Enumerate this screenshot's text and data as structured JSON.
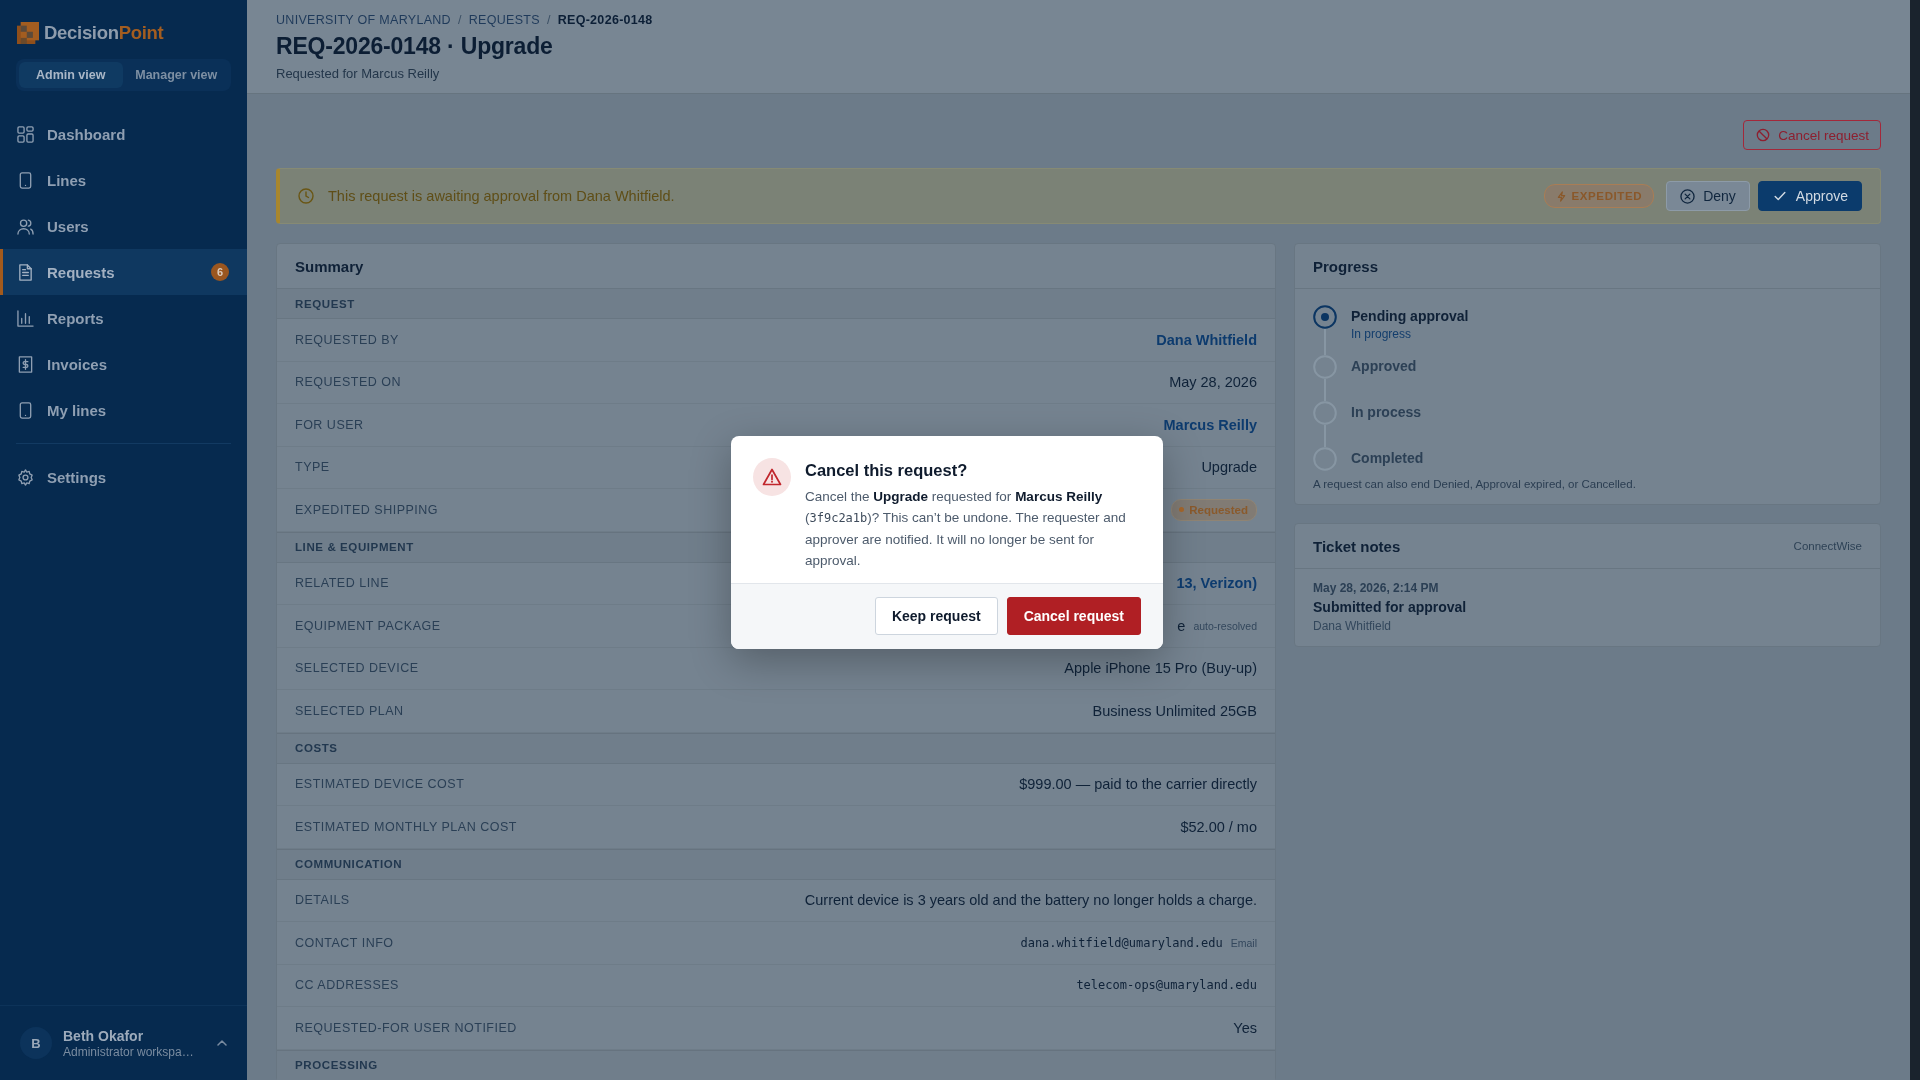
{
  "sidebar": {
    "logo": {
      "first": "Decision",
      "second": "Point"
    },
    "views": [
      {
        "label": "Admin view",
        "selected": true
      },
      {
        "label": "Manager view",
        "selected": false
      }
    ],
    "nav": [
      {
        "label": "Dashboard",
        "selected": false
      },
      {
        "label": "Lines",
        "selected": false
      },
      {
        "label": "Users",
        "selected": false
      },
      {
        "label": "Requests",
        "selected": true,
        "badge": "6"
      },
      {
        "label": "Reports",
        "selected": false
      },
      {
        "label": "Invoices",
        "selected": false
      },
      {
        "label": "My lines",
        "selected": false
      }
    ],
    "nav_footer": [
      {
        "label": "Settings",
        "selected": false
      }
    ],
    "user": {
      "initial": "B",
      "name": "Beth Okafor",
      "role": "Administrator workspa…"
    }
  },
  "header": {
    "breadcrumb": [
      {
        "label": "UNIVERSITY OF MARYLAND",
        "current": false
      },
      {
        "label": "REQUESTS",
        "current": false
      },
      {
        "label": "REQ-2026-0148",
        "current": true
      }
    ],
    "breadcrumb_separator": "/",
    "title": "REQ-2026-0148 · Upgrade",
    "subtitle": "Requested for Marcus Reilly"
  },
  "actions": {
    "cancel": "Cancel request"
  },
  "banner": {
    "message": "This request is awaiting approval from Dana Whitfield.",
    "tag": "EXPEDITED",
    "deny": "Deny",
    "approve": "Approve"
  },
  "summary": {
    "title": "Summary",
    "rows": [
      {
        "kind": "section",
        "label": "REQUEST"
      },
      {
        "kind": "link",
        "label": "REQUESTED BY",
        "value": "Dana Whitfield"
      },
      {
        "kind": "text",
        "label": "REQUESTED ON",
        "value": "May 28, 2026"
      },
      {
        "kind": "link",
        "label": "FOR USER",
        "value": "Marcus Reilly"
      },
      {
        "kind": "text",
        "label": "TYPE",
        "value": "Upgrade"
      },
      {
        "kind": "badge",
        "label": "EXPEDITED SHIPPING",
        "value": "Requested"
      },
      {
        "kind": "section",
        "label": "LINE & EQUIPMENT"
      },
      {
        "kind": "link",
        "label": "RELATED LINE",
        "value": "13, Verizon)"
      },
      {
        "kind": "text",
        "label": "EQUIPMENT PACKAGE",
        "value": "e",
        "note": "auto-resolved"
      },
      {
        "kind": "text",
        "label": "SELECTED DEVICE",
        "value": "Apple iPhone 15 Pro (Buy-up)"
      },
      {
        "kind": "text",
        "label": "SELECTED PLAN",
        "value": "Business Unlimited 25GB"
      },
      {
        "kind": "section",
        "label": "COSTS"
      },
      {
        "kind": "text",
        "label": "ESTIMATED DEVICE COST",
        "value": "$999.00 — paid to the carrier directly"
      },
      {
        "kind": "text",
        "label": "ESTIMATED MONTHLY PLAN COST",
        "value": "$52.00 / mo"
      },
      {
        "kind": "section",
        "label": "COMMUNICATION"
      },
      {
        "kind": "text",
        "label": "DETAILS",
        "value": "Current device is 3 years old and the battery no longer holds a charge."
      },
      {
        "kind": "mono",
        "label": "CONTACT INFO",
        "value": "dana.whitfield@umaryland.edu",
        "note": "Email"
      },
      {
        "kind": "mono",
        "label": "CC ADDRESSES",
        "value": "telecom-ops@umaryland.edu"
      },
      {
        "kind": "text",
        "label": "REQUESTED-FOR USER NOTIFIED",
        "value": "Yes"
      },
      {
        "kind": "section",
        "label": "PROCESSING"
      }
    ]
  },
  "progress": {
    "title": "Progress",
    "steps": [
      {
        "label": "Pending approval",
        "status": "In progress",
        "current": true
      },
      {
        "label": "Approved",
        "current": false
      },
      {
        "label": "In process",
        "current": false
      },
      {
        "label": "Completed",
        "current": false
      }
    ],
    "note": "A request can also end Denied, Approval expired, or Cancelled."
  },
  "ticket_notes": {
    "title": "Ticket notes",
    "source": "ConnectWise",
    "notes": [
      {
        "time": "May 28, 2026, 2:14 PM",
        "text": "Submitted for approval",
        "author": "Dana Whitfield"
      }
    ]
  },
  "dialog": {
    "title": "Cancel this request?",
    "message": [
      {
        "kind": "text",
        "text": "Cancel the **Upgrade** requested for **Marcus Reilly** ("
      },
      {
        "kind": "code",
        "text": "3f9c2a1b"
      },
      {
        "kind": "text",
        "text": ")? This can’t be undone. The requester and approver are notified. It will no longer be sent for approval."
      }
    ],
    "buttons": [
      {
        "label": "Keep request",
        "kind": "secondary"
      },
      {
        "label": "Cancel request",
        "kind": "danger"
      }
    ]
  }
}
